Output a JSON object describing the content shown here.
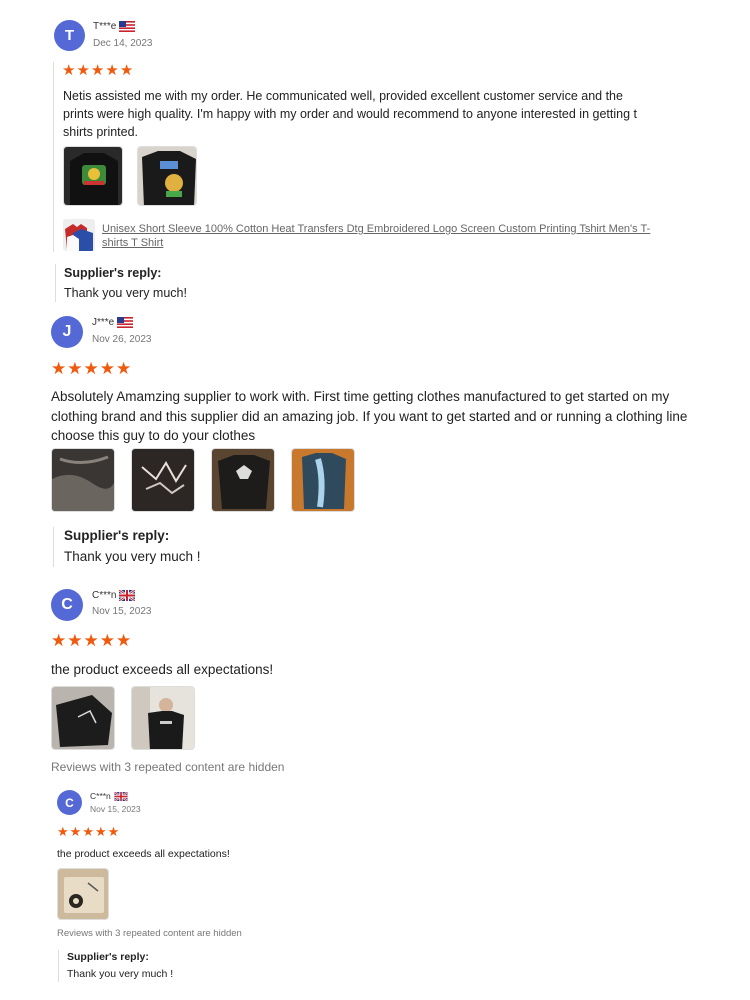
{
  "reviews": [
    {
      "avatar_letter": "T",
      "user": "T***e",
      "flag": "us",
      "date": "Dec 14, 2023",
      "stars": 5,
      "text": "Netis assisted me with my order. He communicated well, provided excellent customer service and the prints were high quality. I'm happy with my order and would recommend to anyone interested in getting t shirts printed.",
      "photos": [
        "black-tshirt-colorful-print-photo",
        "black-tshirt-back-print-photo"
      ],
      "product_link": "Unisex Short Sleeve 100% Cotton Heat Transfers Dtg Embroidered Logo Screen Custom Printing Tshirt Men's T-shirts T Shirt",
      "reply_title": "Supplier's reply:",
      "reply_text": "Thank you very much!"
    },
    {
      "avatar_letter": "J",
      "user": "J***e",
      "flag": "us",
      "date": "Nov 26, 2023",
      "stars": 5,
      "text": "Absolutely Amamzing supplier to work with. First time getting clothes manufactured to get started on my clothing brand and this supplier did an amazing job. If you want to get started and or running a clothing line choose this guy to do your clothes",
      "photos": [
        "acid-wash-tshirt-photo",
        "distressed-print-tshirt-photo",
        "black-tshirt-on-floor-photo",
        "blue-print-tshirt-photo"
      ],
      "reply_title": "Supplier's reply:",
      "reply_text": "Thank you very much !"
    },
    {
      "avatar_letter": "C",
      "user": "C***n",
      "flag": "uk",
      "date": "Nov 15, 2023",
      "stars": 5,
      "text": "the product exceeds all expectations!",
      "photos": [
        "folded-black-shirt-photo",
        "person-wearing-black-shirt-photo"
      ],
      "hidden_note": "Reviews with 3 repeated content are hidden"
    },
    {
      "avatar_letter": "C",
      "user": "C***n",
      "flag": "uk",
      "date": "Nov 15, 2023",
      "stars": 5,
      "text": "the product exceeds all expectations!",
      "photos": [
        "beige-bag-logo-photo"
      ],
      "hidden_note": "Reviews with 3 repeated content are hidden",
      "reply_title": "Supplier's reply:",
      "reply_text": "Thank you very much !"
    }
  ],
  "colors": {
    "avatar": "#5468d6",
    "star": "#f05a0e"
  }
}
